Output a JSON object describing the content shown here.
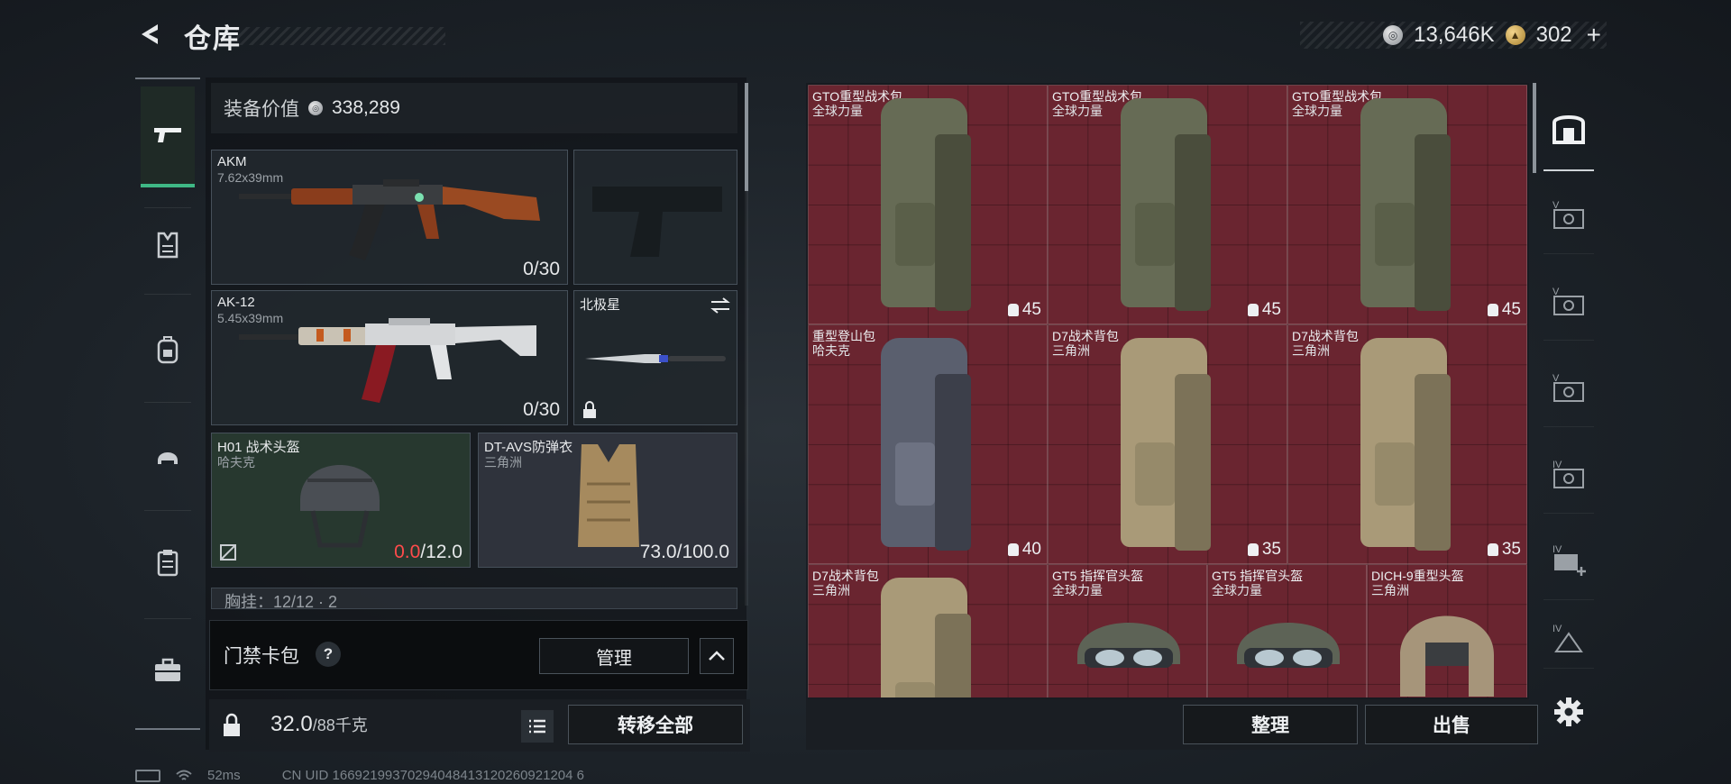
{
  "header": {
    "title": "仓库",
    "currency_silver": "13,646K",
    "currency_gold": "302"
  },
  "equipment": {
    "value_label": "装备价值",
    "value": "338,289",
    "slots": [
      {
        "name": "AKM",
        "sub": "7.62x39mm",
        "count": "0/30"
      },
      {
        "name": "",
        "sub": "",
        "count": ""
      },
      {
        "name": "AK-12",
        "sub": "5.45x39mm",
        "count": "0/30"
      },
      {
        "name": "北极星",
        "sub": "",
        "count": ""
      },
      {
        "name": "H01 战术头盔",
        "sub": "哈夫克",
        "dur_current": "0.0",
        "dur_max": "/12.0"
      },
      {
        "name": "DT-AVS防弹衣",
        "sub": "三角洲",
        "count": "73.0/100.0"
      }
    ],
    "chest_rig_row": "胸挂：12/12 · 2",
    "keycard_label": "门禁卡包",
    "manage_label": "管理",
    "weight_value": "32.0",
    "weight_max": "/88千克",
    "transfer_label": "转移全部"
  },
  "storage": {
    "items": [
      {
        "name": "GTO重型战术包",
        "sub": "全球力量",
        "capacity": "45"
      },
      {
        "name": "GTO重型战术包",
        "sub": "全球力量",
        "capacity": "45"
      },
      {
        "name": "GTO重型战术包",
        "sub": "全球力量",
        "capacity": "45"
      },
      {
        "name": "重型登山包",
        "sub": "哈夫克",
        "capacity": "40"
      },
      {
        "name": "D7战术背包",
        "sub": "三角洲",
        "capacity": "35"
      },
      {
        "name": "D7战术背包",
        "sub": "三角洲",
        "capacity": "35"
      },
      {
        "name": "D7战术背包",
        "sub": "三角洲",
        "capacity": ""
      },
      {
        "name": "GT5 指挥官头盔",
        "sub": "全球力量",
        "capacity": ""
      },
      {
        "name": "GT5 指挥官头盔",
        "sub": "全球力量",
        "capacity": ""
      },
      {
        "name": "DICH-9重型头盔",
        "sub": "三角洲",
        "capacity": ""
      }
    ],
    "sort_label": "整理",
    "sell_label": "出售"
  },
  "status_bar": {
    "ping": "52ms",
    "uid": "CN UID 16692199370294048413120260921204 6"
  },
  "icons": {
    "back": "back-arrow-icon",
    "rail": [
      "gun-icon",
      "armor-icon",
      "backpack-icon",
      "helmet-icon",
      "clipboard-icon",
      "briefcase-icon"
    ],
    "right_rail": [
      "safe-icon",
      "stash-v-icon",
      "stash-v-icon",
      "stash-v-icon",
      "stash-iv-icon",
      "stash-iv-add-icon",
      "stash-iv-icon"
    ],
    "settings": "gear-icon"
  },
  "colors": {
    "accent_green": "#3fb885",
    "grid_red": "#6a2530",
    "durability_zero": "#ff4b4b"
  }
}
